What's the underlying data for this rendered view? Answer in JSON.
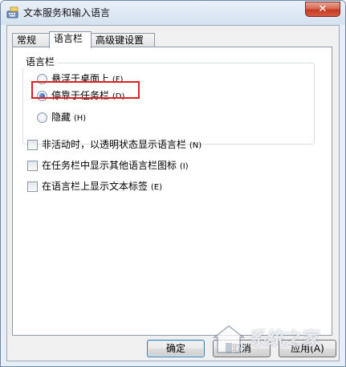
{
  "window": {
    "title": "文本服务和输入语言",
    "close_glyph": "✕"
  },
  "tabs": [
    {
      "label": "常规",
      "active": false
    },
    {
      "label": "语言栏",
      "active": true
    },
    {
      "label": "高级键设置",
      "active": false
    }
  ],
  "language_bar_group": {
    "title": "语言栏",
    "options": [
      {
        "text": "悬浮于桌面上",
        "hotkey": "(F)",
        "checked": false
      },
      {
        "text": "停靠于任务栏",
        "hotkey": "(D)",
        "checked": true
      },
      {
        "text": "隐藏",
        "hotkey": "(H)",
        "checked": false
      }
    ]
  },
  "checkboxes": [
    {
      "text": "非活动时，以透明状态显示语言栏",
      "hotkey": "(N)",
      "checked": false
    },
    {
      "text": "在任务栏中显示其他语言栏图标",
      "hotkey": "(I)",
      "checked": false
    },
    {
      "text": "在语言栏上显示文本标签",
      "hotkey": "(E)",
      "checked": false
    }
  ],
  "buttons": {
    "ok": "确定",
    "cancel": "取消",
    "apply": "应用(A)"
  },
  "watermark": {
    "text": "系统之家"
  },
  "colors": {
    "highlight": "#e02020",
    "close_button": "#c53a22",
    "panel_bg": "#ffffff",
    "frame_bg": "#f0f0f0"
  }
}
